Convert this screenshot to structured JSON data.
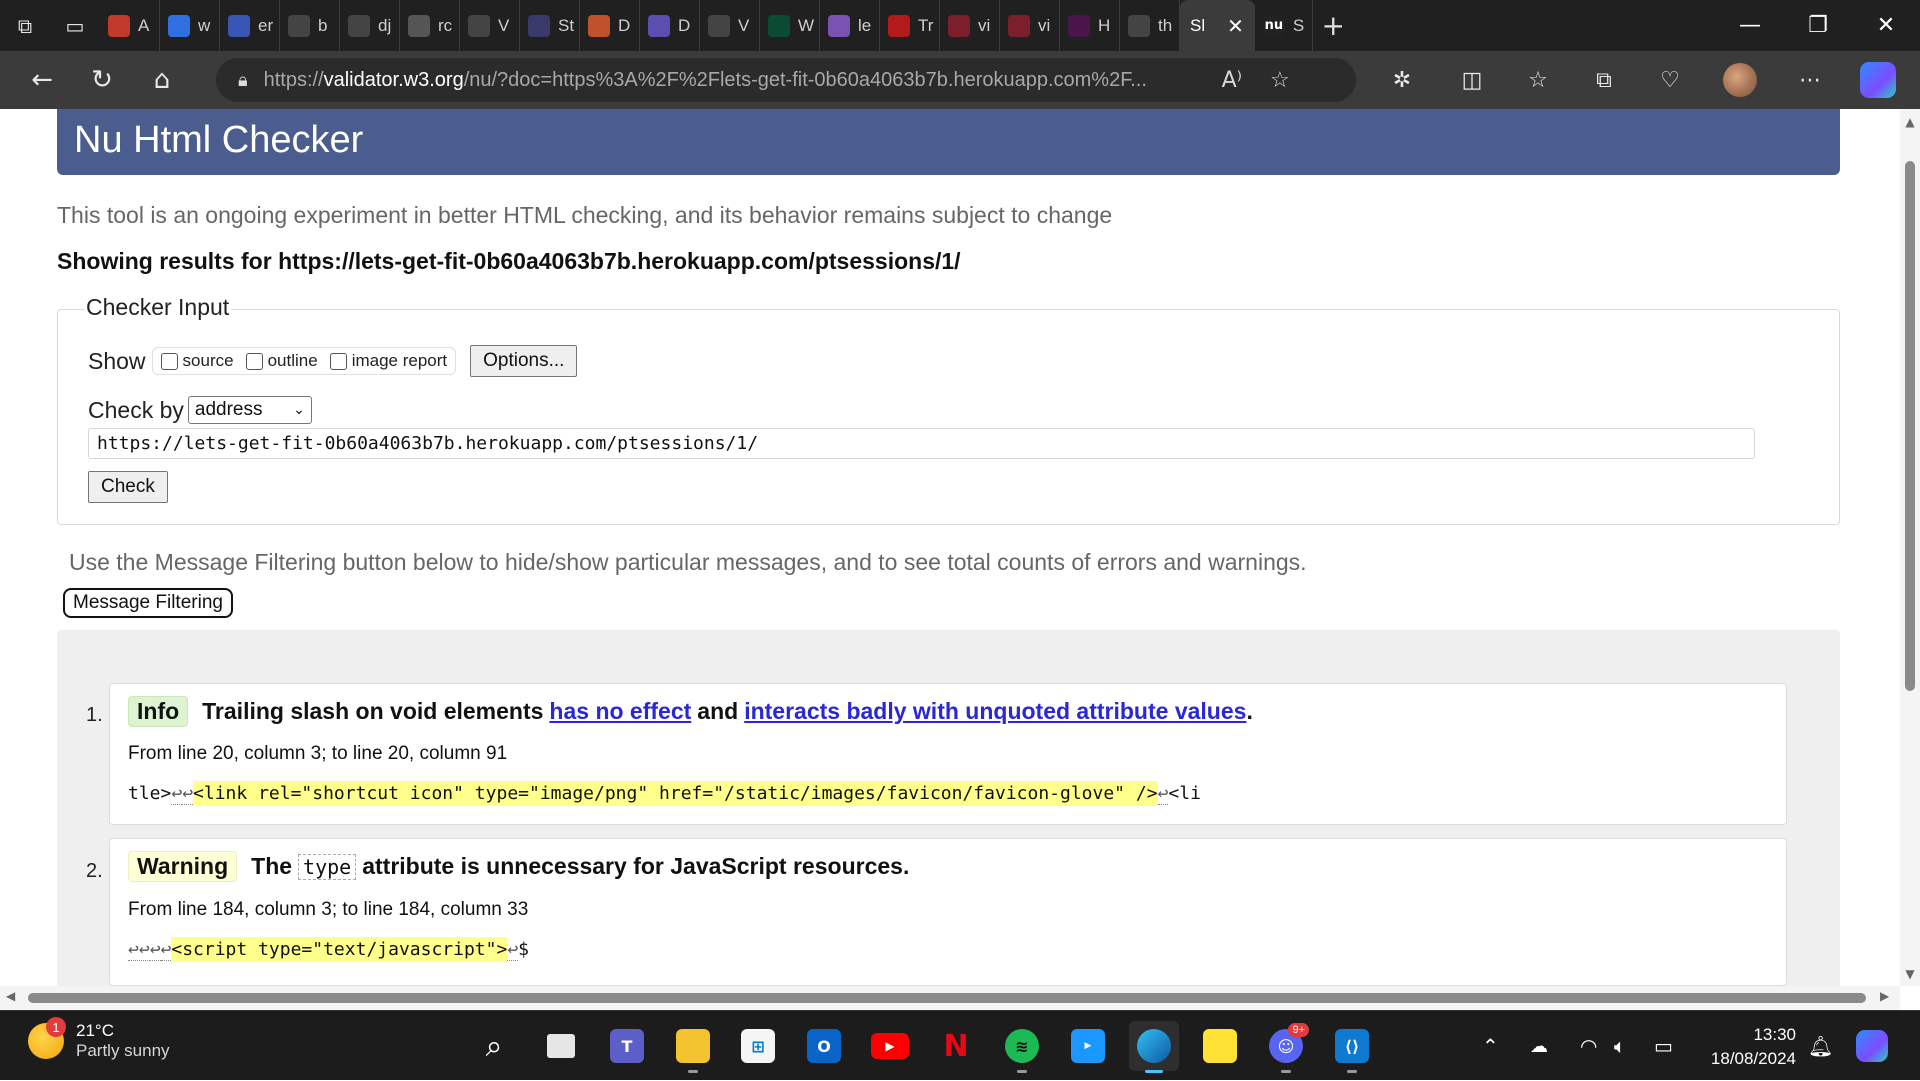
{
  "browser": {
    "tabs": [
      {
        "label": "A",
        "icon": "opera-icon",
        "color": "#c0392b"
      },
      {
        "label": "w",
        "icon": "bing-icon",
        "color": "#2f6fe0"
      },
      {
        "label": "er",
        "icon": "search-icon",
        "color": "#3a56b5"
      },
      {
        "label": "b",
        "icon": "github-icon",
        "color": "#444"
      },
      {
        "label": "dj",
        "icon": "github-icon",
        "color": "#444"
      },
      {
        "label": "rc",
        "icon": "google-icon",
        "color": "#555"
      },
      {
        "label": "V",
        "icon": "github-icon",
        "color": "#444"
      },
      {
        "label": "St",
        "icon": "stackedit-icon",
        "color": "#3a3a6a"
      },
      {
        "label": "D",
        "icon": "generic-icon",
        "color": "#c0522b"
      },
      {
        "label": "D",
        "icon": "stackedit-icon",
        "color": "#5a4fb0"
      },
      {
        "label": "V",
        "icon": "github-icon",
        "color": "#444"
      },
      {
        "label": "W",
        "icon": "django-icon",
        "color": "#0c4b33"
      },
      {
        "label": "le",
        "icon": "heroku-icon",
        "color": "#7952b3"
      },
      {
        "label": "Tr",
        "icon": "code-institute-icon",
        "color": "#b31b1b"
      },
      {
        "label": "vi",
        "icon": "code-institute-icon",
        "color": "#7a1f2b"
      },
      {
        "label": "vi",
        "icon": "code-institute-icon",
        "color": "#7a1f2b"
      },
      {
        "label": "H",
        "icon": "slack-icon",
        "color": "#4a154b"
      },
      {
        "label": "th",
        "icon": "github-icon",
        "color": "#444"
      }
    ],
    "active_tab": {
      "label": "Sl",
      "icon_text": "nu"
    },
    "trailing_tab": {
      "label": "S",
      "icon_text": "nu"
    },
    "address": {
      "scheme": "https://",
      "host": "validator.w3.org",
      "rest": "/nu/?doc=https%3A%2F%2Flets-get-fit-0b60a4063b7b.herokuapp.com%2F..."
    }
  },
  "page": {
    "title": "Nu Html Checker",
    "intro": "This tool is an ongoing experiment in better HTML checking, and its behavior remains subject to change",
    "showing": "Showing results for https://lets-get-fit-0b60a4063b7b.herokuapp.com/ptsessions/1/",
    "checker_input": {
      "legend": "Checker Input",
      "show_label": "Show",
      "options": [
        "source",
        "outline",
        "image report"
      ],
      "options_button": "Options...",
      "check_by_label": "Check by",
      "check_by_value": "address",
      "url_value": "https://lets-get-fit-0b60a4063b7b.herokuapp.com/ptsessions/1/",
      "check_button": "Check"
    },
    "filter_note": "Use the Message Filtering button below to hide/show particular messages, and to see total counts of errors and warnings.",
    "filter_button": "Message Filtering",
    "messages": [
      {
        "num": "1.",
        "type": "Info",
        "text_a": "Trailing slash on void elements",
        "link1": "has no effect",
        "text_b": "and",
        "link2": "interacts badly with unquoted attribute values",
        "text_c": ".",
        "location": "From line 20, column 3; to line 20, column 91",
        "extract_pre": "tle>",
        "extract_mark": "<link rel=\"shortcut icon\" type=\"image/png\" href=\"/static/images/favicon/favicon-glove\" />",
        "extract_post": "<li"
      },
      {
        "num": "2.",
        "type": "Warning",
        "text_a": "The",
        "code": "type",
        "text_b": "attribute is unnecessary for JavaScript resources.",
        "location": "From line 184, column 3; to line 184, column 33",
        "extract_mark": "<script type=\"text/javascript\">",
        "extract_post": "$"
      }
    ]
  },
  "taskbar": {
    "weather_temp": "21°C",
    "weather_desc": "Partly sunny",
    "weather_badge": "1",
    "time": "13:30",
    "date": "18/08/2024",
    "discord_badge": "9+"
  }
}
